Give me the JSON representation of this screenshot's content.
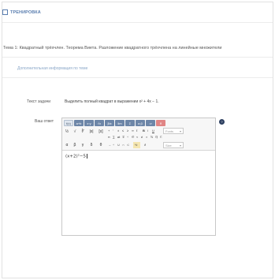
{
  "header": {
    "title": "ТРЕНИРОВКА"
  },
  "topic": {
    "text": "Тема 1: Квадратный трёхчлен. Теорема Виета. Разложение квадратного трёхчлена на линейные множители"
  },
  "additional_info": {
    "link": "Дополнительная информация по теме"
  },
  "task": {
    "label": "Текст задачи",
    "text": "Выделить полный квадрат в выражении x² + 4x − 1."
  },
  "answer": {
    "label": "Ваш ответ",
    "value": "(x+2)²−5",
    "toolbar": {
      "tabs": [
        "f(x)",
        "a+b",
        "x·y",
        "√x",
        "∫dx",
        "lim",
        "Σ",
        "α β",
        "⇒",
        "✕"
      ],
      "help": "?",
      "row1": [
        "½",
        "√",
        "∛",
        "|x|",
        "[x]",
        "+",
        "′",
        "±",
        "≤",
        "≥",
        "∞",
        "ℓ",
        "B",
        "i",
        "U"
      ],
      "row2": [
        "π",
        "∑",
        "⇌",
        "∓",
        "÷",
        "∈",
        "≈",
        "≠",
        "×",
        "ℕ",
        "ℚ",
        "ℂ"
      ],
      "row3": [
        "α",
        "β",
        "γ",
        "δ",
        "θ",
        "→",
        "÷",
        "∪",
        "∩",
        "⊂",
        "½",
        "∂"
      ],
      "dropdown1": "Fonts",
      "dropdown2": "Size"
    }
  }
}
